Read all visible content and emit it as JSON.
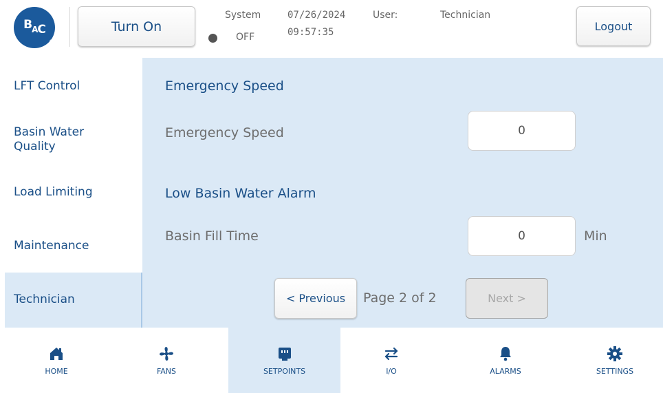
{
  "header": {
    "logo_text": "BAC",
    "turn_on_label": "Turn On",
    "system_label": "System",
    "system_state": "OFF",
    "date": "07/26/2024",
    "time": "09:57:35",
    "user_label": "User:",
    "user_value": "Technician",
    "logout_label": "Logout"
  },
  "sidebar": {
    "items": [
      {
        "label": "LFT Control"
      },
      {
        "label": "Basin Water Quality"
      },
      {
        "label": "Load Limiting"
      },
      {
        "label": "Maintenance"
      },
      {
        "label": "Technician"
      }
    ],
    "active": "Technician"
  },
  "main": {
    "section1_title": "Emergency Speed",
    "emergency_speed_label": "Emergency Speed",
    "emergency_speed_value": "0",
    "section2_title": "Low Basin Water Alarm",
    "basin_fill_label": "Basin Fill Time",
    "basin_fill_value": "0",
    "basin_fill_unit": "Min",
    "prev_label": "< Previous",
    "page_info": "Page 2 of 2",
    "next_label": "Next >"
  },
  "bottom_nav": {
    "items": [
      {
        "label": "HOME",
        "icon": "home-icon"
      },
      {
        "label": "FANS",
        "icon": "fan-icon"
      },
      {
        "label": "SETPOINTS",
        "icon": "setpoints-icon"
      },
      {
        "label": "I/O",
        "icon": "io-arrows-icon"
      },
      {
        "label": "ALARMS",
        "icon": "bell-icon"
      },
      {
        "label": "SETTINGS",
        "icon": "gear-icon"
      }
    ],
    "active": "SETPOINTS"
  },
  "colors": {
    "accent": "#1a4f87",
    "logo_blue": "#1b5a9c",
    "panel_bg": "#dbe9f6",
    "muted_text": "#6e6e6e"
  }
}
